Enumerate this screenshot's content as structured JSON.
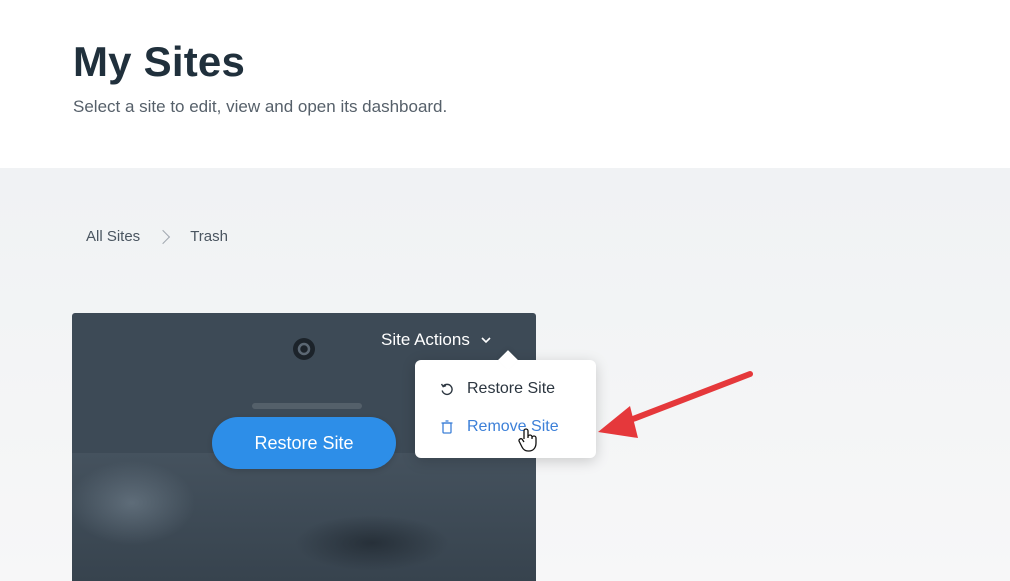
{
  "header": {
    "title": "My Sites",
    "subtitle": "Select a site to edit, view and open its dashboard."
  },
  "breadcrumb": {
    "items": [
      "All Sites",
      "Trash"
    ]
  },
  "site_card": {
    "actions_label": "Site Actions",
    "restore_button": "Restore Site"
  },
  "dropdown": {
    "items": [
      {
        "label": "Restore Site",
        "icon": "undo-icon"
      },
      {
        "label": "Remove Site",
        "icon": "trash-icon"
      }
    ]
  },
  "colors": {
    "title": "#20303c",
    "primary_button": "#2d8ee8",
    "link_blue": "#3d80d8",
    "annotation_arrow": "#e5383b",
    "card_background": "#3d4a56"
  }
}
